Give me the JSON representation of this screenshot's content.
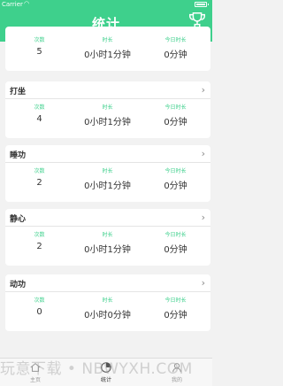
{
  "status_bar": {
    "carrier": "Carrier",
    "time": ""
  },
  "header": {
    "title": "统计",
    "trophy_icon": "trophy-icon",
    "accent": "#3ed08c"
  },
  "cards": [
    {
      "title": "",
      "stats": [
        {
          "label": "次数",
          "value": "5"
        },
        {
          "label": "时长",
          "value": "0小时1分钟"
        },
        {
          "label": "今日时长",
          "value": "0分钟"
        }
      ]
    },
    {
      "title": "打坐",
      "stats": [
        {
          "label": "次数",
          "value": "4"
        },
        {
          "label": "时长",
          "value": "0小时1分钟"
        },
        {
          "label": "今日时长",
          "value": "0分钟"
        }
      ]
    },
    {
      "title": "睡功",
      "stats": [
        {
          "label": "次数",
          "value": "2"
        },
        {
          "label": "时长",
          "value": "0小时1分钟"
        },
        {
          "label": "今日时长",
          "value": "0分钟"
        }
      ]
    },
    {
      "title": "静心",
      "stats": [
        {
          "label": "次数",
          "value": "2"
        },
        {
          "label": "时长",
          "value": "0小时1分钟"
        },
        {
          "label": "今日时长",
          "value": "0分钟"
        }
      ]
    },
    {
      "title": "动功",
      "stats": [
        {
          "label": "次数",
          "value": "0"
        },
        {
          "label": "时长",
          "value": "0小时0分钟"
        },
        {
          "label": "今日时长",
          "value": "0分钟"
        }
      ]
    }
  ],
  "tabbar": {
    "items": [
      {
        "label": "主页",
        "icon": "home-icon"
      },
      {
        "label": "统计",
        "icon": "stats-icon"
      },
      {
        "label": "我的",
        "icon": "profile-icon"
      }
    ]
  },
  "watermark": "玩意下载 • NBWYXH.COM"
}
